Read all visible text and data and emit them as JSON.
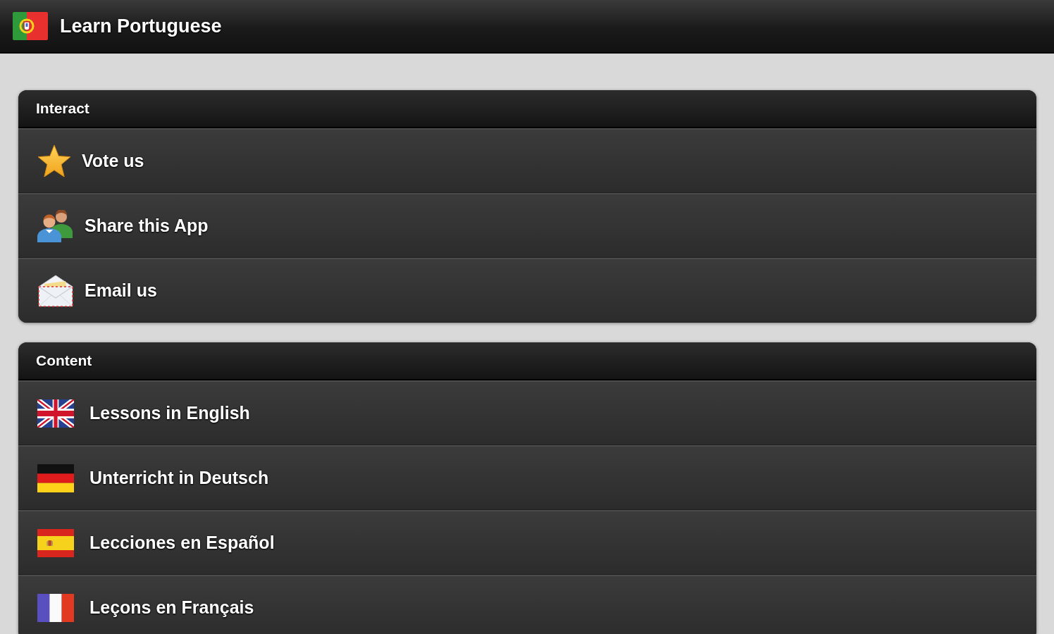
{
  "app_bar": {
    "title": "Learn Portuguese"
  },
  "sections": [
    {
      "title": "Interact",
      "items": [
        {
          "label": "Vote us"
        },
        {
          "label": "Share this App"
        },
        {
          "label": "Email us"
        }
      ]
    },
    {
      "title": "Content",
      "items": [
        {
          "label": "Lessons in English"
        },
        {
          "label": "Unterricht in Deutsch"
        },
        {
          "label": "Lecciones en Español"
        },
        {
          "label": "Leçons en Français"
        }
      ]
    }
  ]
}
